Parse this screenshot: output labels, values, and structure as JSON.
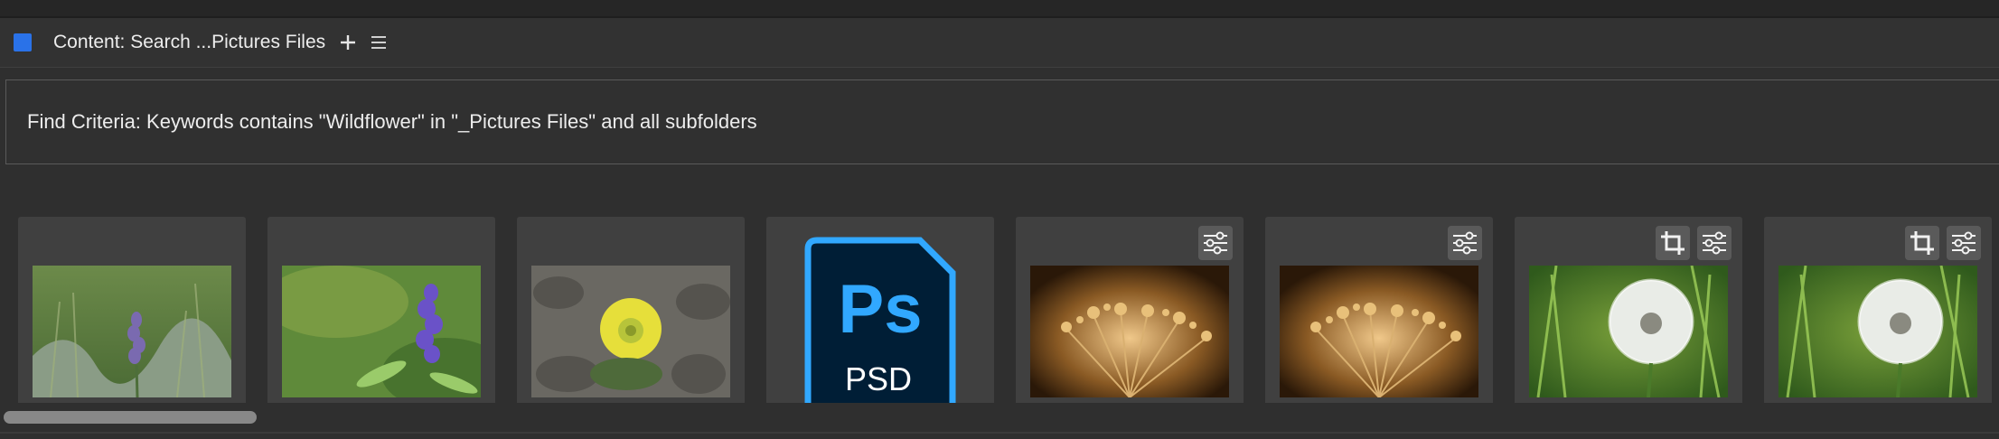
{
  "panel": {
    "title": "Content: Search ...Pictures Files",
    "add_icon": "plus-icon",
    "menu_icon": "hamburger-menu-icon",
    "accent_color": "#2a72e8"
  },
  "criteria": {
    "text": "Find Criteria:  Keywords contains \"Wildflower\" in \"_Pictures Files\" and all subfolders"
  },
  "thumbnails": [
    {
      "kind": "photo",
      "subject": "purple lupine in grass",
      "badges": []
    },
    {
      "kind": "photo",
      "subject": "purple lupine close-up",
      "badges": []
    },
    {
      "kind": "photo",
      "subject": "yellow cactus flower",
      "badges": []
    },
    {
      "kind": "psd",
      "label": "PSD",
      "logo": "Ps",
      "badges": []
    },
    {
      "kind": "photo",
      "subject": "dried umbel seed head",
      "badges": [
        "adjustments-icon"
      ]
    },
    {
      "kind": "photo",
      "subject": "dried umbel seed head",
      "badges": [
        "adjustments-icon"
      ]
    },
    {
      "kind": "photo",
      "subject": "dandelion seed head",
      "badges": [
        "crop-icon",
        "adjustments-icon"
      ]
    },
    {
      "kind": "photo",
      "subject": "dandelion seed head",
      "badges": [
        "crop-icon",
        "adjustments-icon"
      ]
    }
  ]
}
